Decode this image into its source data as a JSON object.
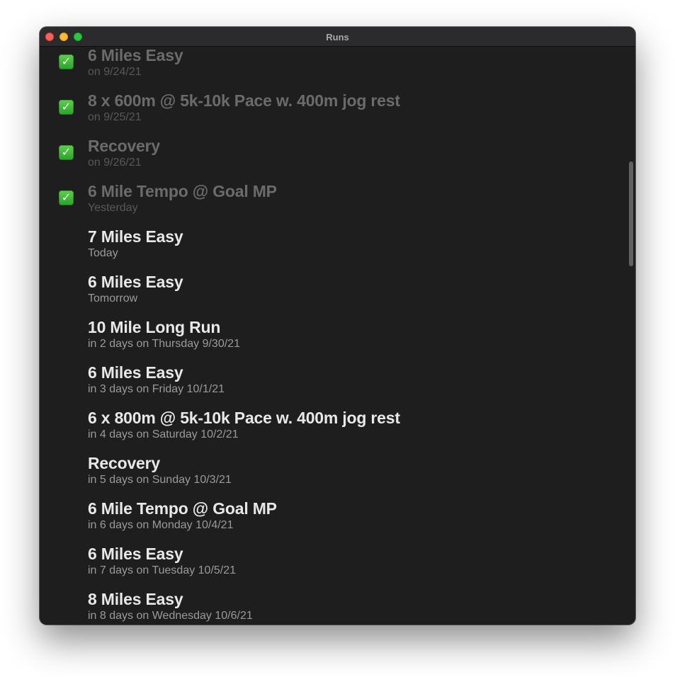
{
  "window": {
    "title": "Runs"
  },
  "runs": [
    {
      "title": "6 Miles Easy",
      "subtitle": "on 9/24/21",
      "completed": true,
      "icon": "checkmark-icon"
    },
    {
      "title": "8 x 600m @ 5k-10k Pace w. 400m jog rest",
      "subtitle": "on 9/25/21",
      "completed": true,
      "icon": "checkmark-icon"
    },
    {
      "title": "Recovery",
      "subtitle": "on 9/26/21",
      "completed": true,
      "icon": "checkmark-icon"
    },
    {
      "title": "6 Mile Tempo @ Goal MP",
      "subtitle": "Yesterday",
      "completed": true,
      "icon": "checkmark-icon"
    },
    {
      "title": "7 Miles Easy",
      "subtitle": "Today",
      "completed": false
    },
    {
      "title": "6 Miles Easy",
      "subtitle": "Tomorrow",
      "completed": false
    },
    {
      "title": "10 Mile Long Run",
      "subtitle": "in 2 days on Thursday 9/30/21",
      "completed": false
    },
    {
      "title": "6 Miles Easy",
      "subtitle": "in 3 days on Friday 10/1/21",
      "completed": false
    },
    {
      "title": "6 x 800m @ 5k-10k Pace w. 400m jog rest",
      "subtitle": "in 4 days on Saturday 10/2/21",
      "completed": false
    },
    {
      "title": "Recovery",
      "subtitle": "in 5 days on Sunday 10/3/21",
      "completed": false
    },
    {
      "title": "6 Mile Tempo @ Goal MP",
      "subtitle": "in 6 days on Monday 10/4/21",
      "completed": false
    },
    {
      "title": "6 Miles Easy",
      "subtitle": "in 7 days on Tuesday 10/5/21",
      "completed": false
    },
    {
      "title": "8 Miles Easy",
      "subtitle": "in 8 days on Wednesday 10/6/21",
      "completed": false
    }
  ],
  "colors": {
    "window_bg": "#1e1e1e",
    "titlebar_bg": "#2b2a2c",
    "title_text": "#e8e8e8",
    "subtitle_text": "#9a9a9a",
    "completed_text": "#6b6b6b",
    "check_green": "#34b233"
  }
}
